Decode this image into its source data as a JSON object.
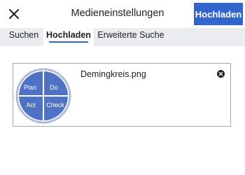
{
  "dialog": {
    "title": "Medieneinstellungen",
    "close_icon": "close-icon",
    "upload_label": "Hochladen"
  },
  "tabs": [
    {
      "label": "Suchen",
      "active": false
    },
    {
      "label": "Hochladen",
      "active": true
    },
    {
      "label": "Erweiterte Suche",
      "active": false
    }
  ],
  "upload": {
    "file_name": "Demingkreis.png",
    "remove_icon": "remove-icon",
    "thumbnail": {
      "quadrants": [
        "Plan",
        "Do",
        "Act",
        "Check"
      ]
    }
  },
  "colors": {
    "accent": "#3366cc",
    "tab_bar": "#eaecf0",
    "thumbnail_blue": "#4f72c4",
    "text": "#202122"
  }
}
